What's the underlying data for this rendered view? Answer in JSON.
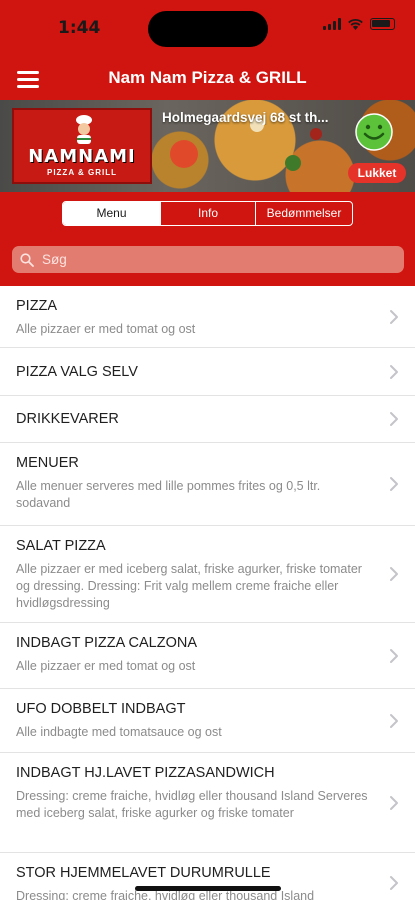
{
  "status_bar": {
    "time": "1:44"
  },
  "navbar": {
    "title": "Nam Nam Pizza & GRILL",
    "menu_icon": "hamburger-icon"
  },
  "banner": {
    "logo_text": "NAMNAMI",
    "logo_subtext": "PIZZA & GRILL",
    "address": "Holmegaardsvej 68 st th...",
    "badge": "Lukket",
    "smiley_icon": "smiley-icon"
  },
  "tabs": [
    {
      "label": "Menu",
      "active": true
    },
    {
      "label": "Info",
      "active": false
    },
    {
      "label": "Bedømmelser",
      "active": false
    }
  ],
  "search": {
    "placeholder": "Søg",
    "value": ""
  },
  "colors": {
    "brand_red": "#d0140f",
    "search_bg": "#e37c70",
    "badge_red": "#e5332a"
  },
  "categories": [
    {
      "title": "PIZZA",
      "description": "Alle pizzaer er med tomat og ost"
    },
    {
      "title": "PIZZA VALG SELV",
      "description": ""
    },
    {
      "title": "DRIKKEVARER",
      "description": ""
    },
    {
      "title": "MENUER",
      "description": "Alle menuer serveres med lille pommes frites og 0,5 ltr. sodavand"
    },
    {
      "title": "SALAT PIZZA",
      "description": "Alle pizzaer er med iceberg salat, friske agurker, friske tomater og dressing. Dressing: Frit valg mellem creme fraiche eller hvidløgsdressing"
    },
    {
      "title": "INDBAGT PIZZA CALZONA",
      "description": "Alle pizzaer er med tomat og ost"
    },
    {
      "title": "UFO DOBBELT INDBAGT",
      "description": "Alle indbagte med tomatsauce og ost"
    },
    {
      "title": "INDBAGT HJ.LAVET PIZZASANDWICH",
      "description": "Dressing: creme fraiche, hvidløg eller thousand Island Serveres med iceberg salat, friske agurker og friske tomater"
    },
    {
      "title": "STOR HJEMMELAVET DURUMRULLE",
      "description": "Dressing: creme fraiche, hvidløg eller thousand Island"
    }
  ]
}
